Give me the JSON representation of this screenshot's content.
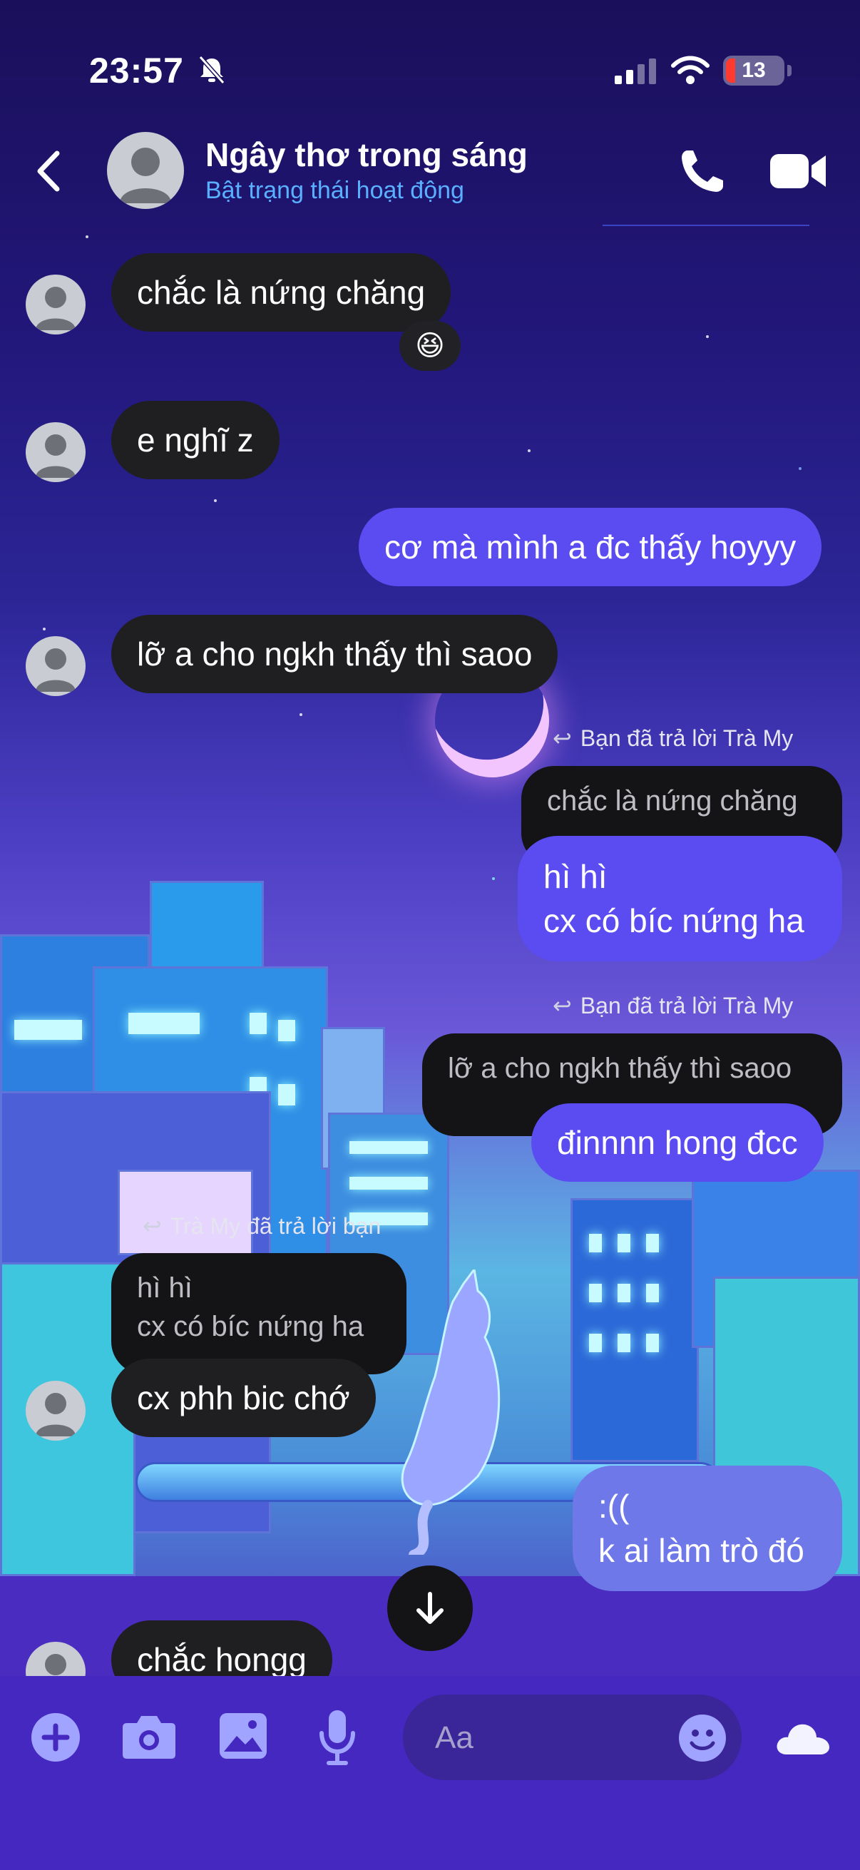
{
  "status_bar": {
    "time": "23:57",
    "battery": "13"
  },
  "header": {
    "name": "Ngây thơ trong sáng",
    "subtitle": "Bật trạng thái hoạt động"
  },
  "messages": [
    {
      "side": "in",
      "text": "chắc là nứng chăng",
      "reaction": "😆"
    },
    {
      "side": "in",
      "text": "e nghĩ z"
    },
    {
      "side": "out",
      "text": "cơ mà mình a đc thấy hoyyy"
    },
    {
      "side": "in",
      "text": "lỡ a cho ngkh thấy thì saoo"
    },
    {
      "side": "out",
      "reply_note": "Bạn đã trả lời Trà My",
      "quoted": "chắc là nứng chăng",
      "line1": "hì hì",
      "line2": "cx có bíc nứng ha"
    },
    {
      "side": "out",
      "reply_note": "Bạn đã trả lời Trà My",
      "quoted": "lỡ a cho ngkh thấy thì saoo",
      "text": "đinnnn hong đcc"
    },
    {
      "side": "in",
      "reply_note": "Trà My đã trả lời bạn",
      "quoted_line1": "hì hì",
      "quoted_line2": "cx có bíc nứng ha",
      "text": "cx phh bic chớ"
    },
    {
      "side": "out",
      "line1": ":((",
      "line2": "k ai làm trò đó"
    },
    {
      "side": "in",
      "text": "chắc hongg"
    }
  ],
  "composer": {
    "placeholder": "Aa"
  },
  "colors": {
    "outgoing_bubble": "#5b4cf2",
    "incoming_bubble": "#1f1f22",
    "status_link": "#5ab0ff"
  },
  "icons": [
    "bell-slash-icon",
    "signal-icon",
    "wifi-icon",
    "back-icon",
    "phone-icon",
    "video-icon",
    "reply-arrow-icon",
    "arrow-down-icon",
    "plus-icon",
    "camera-icon",
    "image-icon",
    "mic-icon",
    "emoji-icon",
    "cloud-icon"
  ]
}
